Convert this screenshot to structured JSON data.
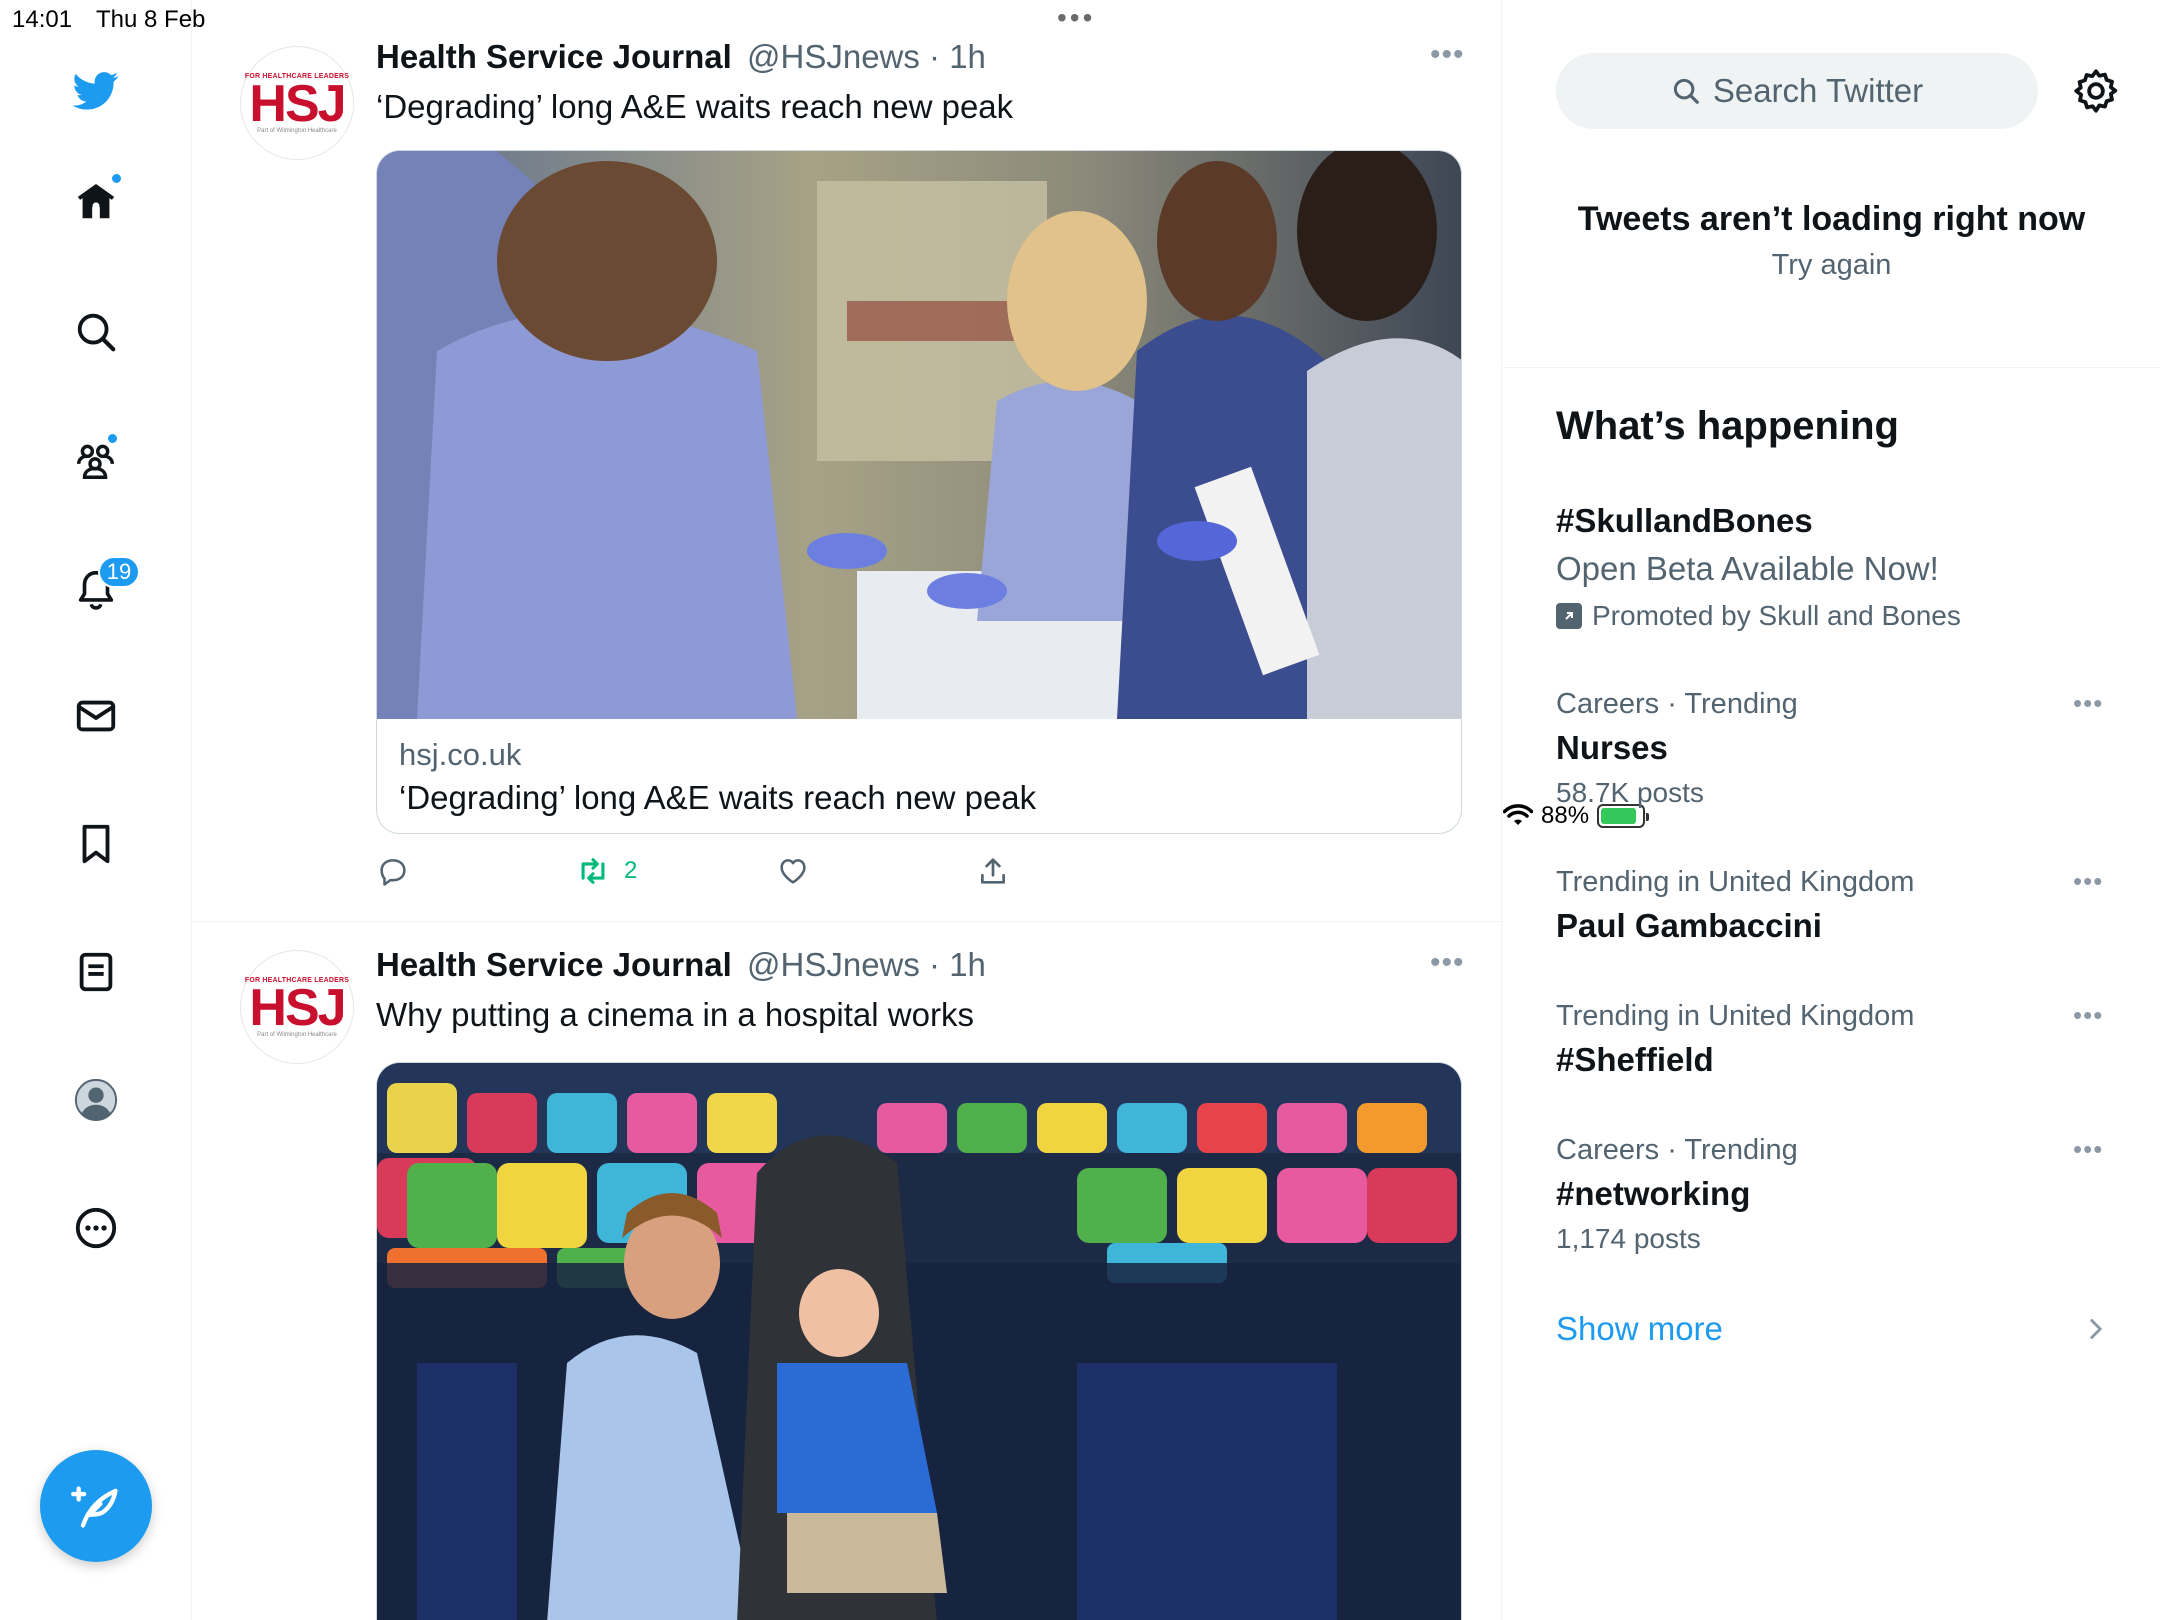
{
  "status_bar": {
    "time": "14:01",
    "date": "Thu 8 Feb",
    "battery": "88%",
    "battery_level": 0.88
  },
  "nav": {
    "notifications_badge": "19",
    "colors": {
      "brand": "#1d9bf0"
    }
  },
  "tweets": [
    {
      "name": "Health Service Journal",
      "handle": "@HSJnews · 1h",
      "text": "‘Degrading’ long A&E waits reach new peak",
      "card_domain": "hsj.co.uk",
      "card_title": "‘Degrading’ long A&E waits reach new peak",
      "retweets": "2",
      "avatar_tagline": "FOR HEALTHCARE LEADERS",
      "avatar_logo": "HSJ",
      "avatar_sub": "Part of Wilmington Healthcare"
    },
    {
      "name": "Health Service Journal",
      "handle": "@HSJnews · 1h",
      "text": "Why putting a cinema in a hospital works",
      "avatar_tagline": "FOR HEALTHCARE LEADERS",
      "avatar_logo": "HSJ",
      "avatar_sub": "Part of Wilmington Healthcare"
    }
  ],
  "sidebar": {
    "search_placeholder": "Search Twitter",
    "error_title": "Tweets aren’t loading right now",
    "error_retry": "Try again",
    "whats_happening": "What’s happening",
    "promoted": {
      "name": "#SkullandBones",
      "subtitle": "Open Beta Available Now!",
      "by": "Promoted by Skull and Bones"
    },
    "trends": [
      {
        "category": "Careers · Trending",
        "name": "Nurses",
        "count": "58.7K posts"
      },
      {
        "category": "Trending in United Kingdom",
        "name": "Paul Gambaccini",
        "count": ""
      },
      {
        "category": "Trending in United Kingdom",
        "name": "#Sheffield",
        "count": ""
      },
      {
        "category": "Careers · Trending",
        "name": "#networking",
        "count": "1,174 posts"
      }
    ],
    "show_more": "Show more"
  }
}
